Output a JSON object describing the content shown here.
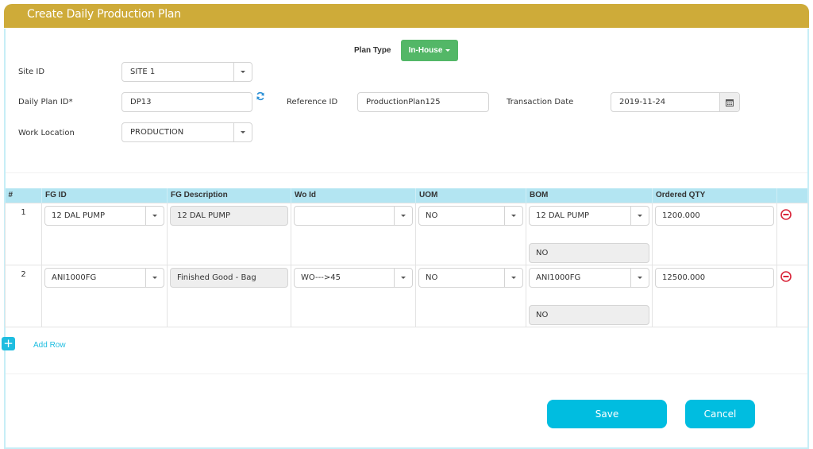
{
  "header": {
    "title": "Create Daily Production Plan"
  },
  "plan_type": {
    "label": "Plan Type",
    "value": "In-House"
  },
  "fields": {
    "site_id": {
      "label": "Site ID",
      "value": "SITE 1"
    },
    "daily_plan_id": {
      "label": "Daily Plan ID*",
      "value": "DP13"
    },
    "work_location": {
      "label": "Work Location",
      "value": "PRODUCTION"
    },
    "reference_id": {
      "label": "Reference ID",
      "value": "ProductionPlan125"
    },
    "transaction_date": {
      "label": "Transaction Date",
      "value": "2019-11-24"
    }
  },
  "table": {
    "headers": [
      "#",
      "FG ID",
      "FG Description",
      "Wo Id",
      "UOM",
      "BOM",
      "Ordered QTY",
      ""
    ],
    "rows": [
      {
        "num": "1",
        "fg_id": "12 DAL PUMP",
        "fg_description": "12 DAL PUMP",
        "wo_id": "",
        "uom": "NO",
        "bom": "12 DAL PUMP",
        "bom_uom": "NO",
        "ordered_qty": "1200.000"
      },
      {
        "num": "2",
        "fg_id": "ANI1000FG",
        "fg_description": "Finished Good - Bag",
        "wo_id": "WO--->45",
        "uom": "NO",
        "bom": "ANI1000FG",
        "bom_uom": "NO",
        "ordered_qty": "12500.000"
      }
    ]
  },
  "add_row": {
    "label": "Add Row"
  },
  "actions": {
    "save": "Save",
    "cancel": "Cancel"
  },
  "colors": {
    "header": "#ceab39",
    "plan_type": "#53b767",
    "accent": "#00bde0",
    "remove": "#d9263a"
  }
}
